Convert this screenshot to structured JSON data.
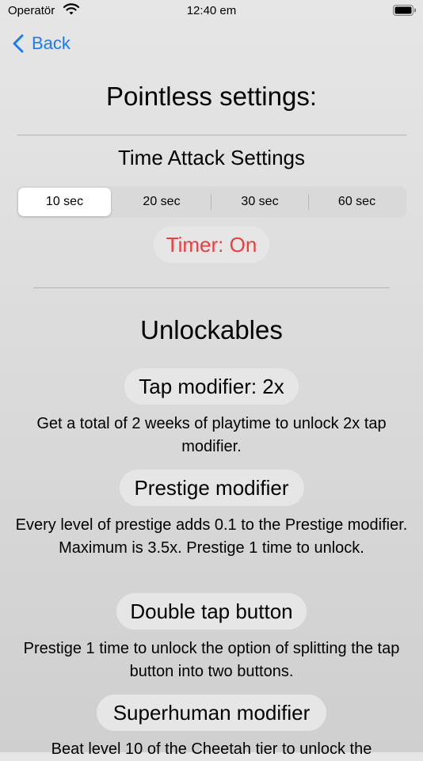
{
  "status": {
    "carrier": "Operatör",
    "time": "12:40 em"
  },
  "nav": {
    "back_label": "Back"
  },
  "title": "Pointless settings:",
  "time_attack": {
    "heading": "Time Attack Settings",
    "segments": [
      "10 sec",
      "20 sec",
      "30 sec",
      "60 sec"
    ],
    "selected_index": 0,
    "timer_label": "Timer: On"
  },
  "unlockables": {
    "heading": "Unlockables",
    "items": [
      {
        "button": "Tap modifier: 2x",
        "description": "Get a total of 2 weeks of playtime to unlock 2x tap modifier."
      },
      {
        "button": "Prestige modifier",
        "description": "Every level of prestige adds 0.1 to the Prestige modifier. Maximum is 3.5x. Prestige 1 time to unlock."
      },
      {
        "button": "Double tap button",
        "description": "Prestige 1 time to unlock the option of splitting the tap button into two buttons."
      },
      {
        "button": "Superhuman modifier",
        "description": "Beat level 10 of the Cheetah tier to unlock the"
      }
    ]
  },
  "colors": {
    "accent": "#1a7cf5",
    "timer_text": "#f03c3c"
  }
}
